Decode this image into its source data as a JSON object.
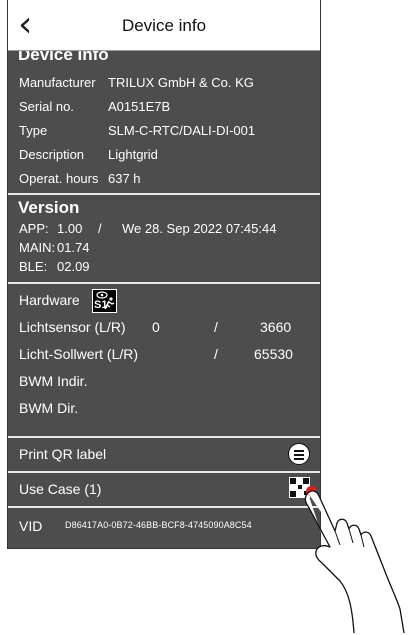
{
  "header": {
    "title": "Device info",
    "back_icon": "chevron-left-icon",
    "back_glyph": "‹"
  },
  "device_info": {
    "section_title": "Device Info",
    "rows": [
      {
        "key": "Manufacturer",
        "value": "TRILUX GmbH & Co. KG"
      },
      {
        "key": "Serial no.",
        "value": "A0151E7B"
      },
      {
        "key": "Type",
        "value": "SLM-C-RTC/DALI-DI-001"
      },
      {
        "key": "Description",
        "value": "Lightgrid"
      },
      {
        "key": "Operat. hours",
        "value": "637 h"
      }
    ]
  },
  "version": {
    "section_title": "Version",
    "app_label": "APP:",
    "app_value": "1.00",
    "app_sep": "/",
    "app_date": "We 28. Sep 2022  07:45:44",
    "main_label": "MAIN:",
    "main_value": "01.74",
    "ble_label": "BLE:",
    "ble_value": "02.09"
  },
  "hardware": {
    "label": "Hardware",
    "badge_text": "S1",
    "badge_icons": [
      "eye-icon",
      "running-person-icon"
    ],
    "lichtsensor_label": "Lichtsensor  (L/R)",
    "lichtsensor_left": "0",
    "lichtsensor_sep": "/",
    "lichtsensor_right": "3660",
    "sollwert_label": "Licht-Sollwert (L/R)",
    "sollwert_sep": "/",
    "sollwert_right": "65530",
    "bwm_indir_label": "BWM Indir.",
    "bwm_dir_label": "BWM Dir."
  },
  "actions": {
    "print_label": "Print QR label",
    "print_icon": "printer-icon",
    "usecase_label": "Use Case (1)",
    "usecase_icon": "qr-code-icon"
  },
  "vid": {
    "label": "VID",
    "value": "D86417A0-0B72-46BB-BCF8-4745090A8C54"
  },
  "overlay": {
    "hand_icon": "pointing-hand-icon",
    "tap_color": "#e0201a"
  },
  "colors": {
    "background": "#4d4d4d",
    "header": "#ffffff",
    "divider": "#e8e8e8",
    "text": "#ffffff"
  }
}
